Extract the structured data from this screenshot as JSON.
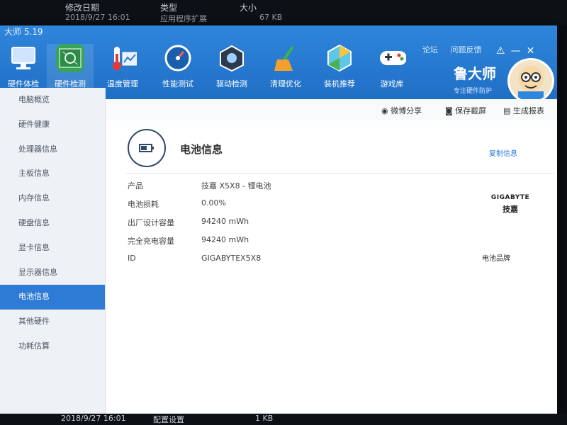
{
  "background_listing": {
    "header": {
      "modified": "修改日期",
      "type": "类型",
      "size": "大小"
    },
    "top_row": {
      "date": "2018/9/27 16:01",
      "type": "应用程序扩展",
      "size": "67 KB"
    },
    "bottom_row": {
      "date": "2018/9/27 16:01",
      "type": "配置设置",
      "size": "1 KB"
    }
  },
  "app": {
    "title": "大师 5.19",
    "title_links": [
      "论坛",
      "问题反馈"
    ],
    "window_controls": [
      "⚠",
      "—",
      "✕"
    ],
    "brand_name": "鲁大师",
    "brand_tagline": "专注硬件防护"
  },
  "toolbar": [
    {
      "label": "硬件体检",
      "icon": "monitor-icon"
    },
    {
      "label": "硬件检测",
      "icon": "circuit-board-icon"
    },
    {
      "label": "温度管理",
      "icon": "thermometer-icon"
    },
    {
      "label": "性能测试",
      "icon": "speedometer-icon"
    },
    {
      "label": "驱动检测",
      "icon": "driver-cube-icon"
    },
    {
      "label": "清理优化",
      "icon": "broom-icon"
    },
    {
      "label": "装机推荐",
      "icon": "hexagon-icon"
    },
    {
      "label": "游戏库",
      "icon": "gamepad-icon"
    }
  ],
  "sidebar": [
    {
      "label": "电脑概览"
    },
    {
      "label": "硬件健康"
    },
    {
      "label": "处理器信息"
    },
    {
      "label": "主板信息"
    },
    {
      "label": "内存信息"
    },
    {
      "label": "硬盘信息"
    },
    {
      "label": "显卡信息"
    },
    {
      "label": "显示器信息"
    },
    {
      "label": "电池信息"
    },
    {
      "label": "其他硬件"
    },
    {
      "label": "功耗估算"
    }
  ],
  "actions": {
    "share": "微博分享",
    "screenshot": "保存截屏",
    "report": "生成报表"
  },
  "panel": {
    "title": "电池信息",
    "copy": "复制信息",
    "rows": [
      {
        "label": "产品",
        "value": "技嘉 X5X8 -   锂电池"
      },
      {
        "label": "电池损耗",
        "value": "0.00%"
      },
      {
        "label": "出厂设计容量",
        "value": "94240 mWh"
      },
      {
        "label": "完全充电容量",
        "value": "94240 mWh"
      },
      {
        "label": "ID",
        "value": "GIGABYTEX5X8"
      }
    ],
    "brand_logo_en": "GIGABYTE",
    "brand_logo_cn": "技嘉",
    "brand_caption": "电池品牌"
  },
  "colors": {
    "accent": "#2d7bd5",
    "titlebar": "#2f86dc"
  }
}
